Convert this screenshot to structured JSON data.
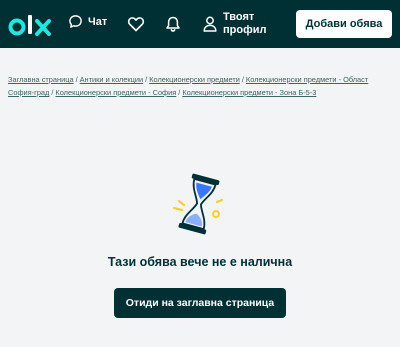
{
  "header": {
    "logo_text": "olx",
    "chat_label": "Чат",
    "profile_label_line1": "Твоят",
    "profile_label_line2": "профил",
    "post_button_label": "Добави обява"
  },
  "breadcrumb": {
    "items": [
      "Заглавна страница",
      "Антики и колекции",
      "Колекционерски предмети",
      "Колекционерски предмети - Област София-град",
      "Колекционерски предмети - София",
      "Колекционерски предмети - Зона Б-5-3"
    ],
    "separator": "/"
  },
  "main": {
    "message": "Тази обява вече не е налична",
    "home_button_label": "Отиди на заглавна страница"
  },
  "colors": {
    "header_bg": "#002f34",
    "page_bg": "#f2f4f5",
    "accent_teal": "#23e5db",
    "hourglass_sand": "#3a77ff",
    "sparkle": "#ffce32"
  }
}
